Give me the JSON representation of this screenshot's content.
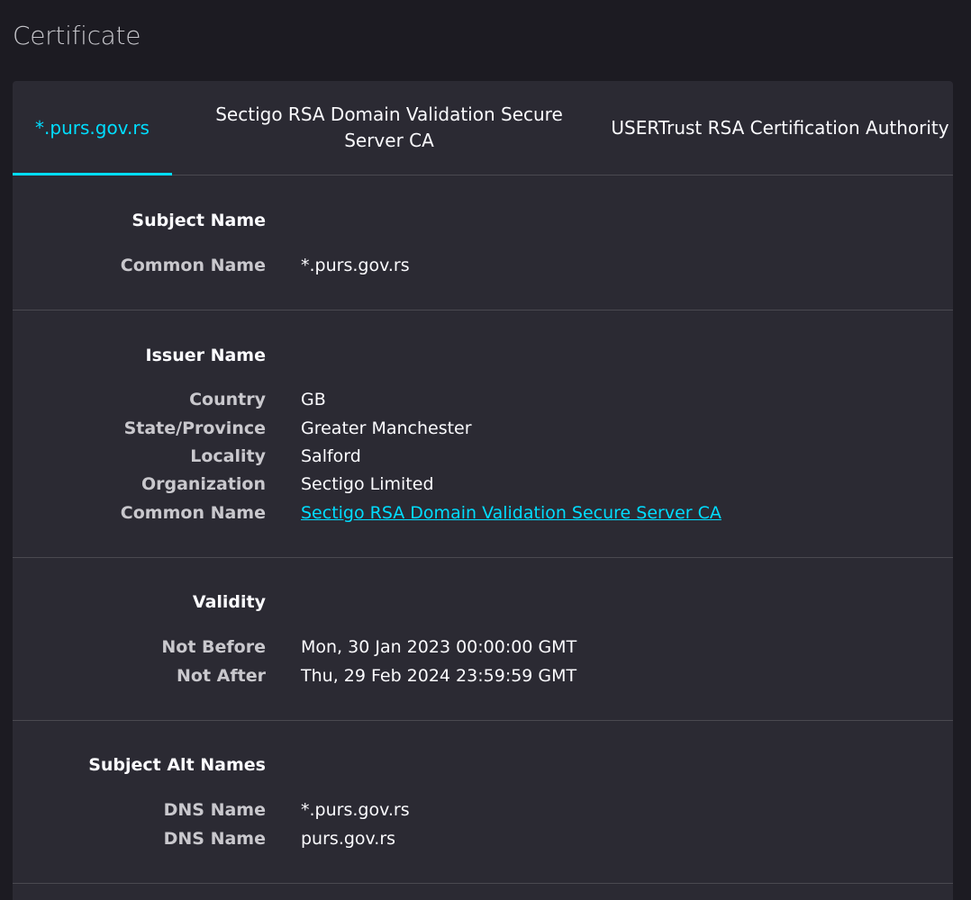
{
  "page": {
    "title": "Certificate"
  },
  "tabs": [
    {
      "label": "*.purs.gov.rs",
      "selected": true
    },
    {
      "label": "Sectigo RSA Domain Validation Secure Server CA",
      "selected": false
    },
    {
      "label": "USERTrust RSA Certification Authority",
      "selected": false
    }
  ],
  "sections": {
    "subject": {
      "heading": "Subject Name",
      "rows": [
        {
          "label": "Common Name",
          "value": "*.purs.gov.rs"
        }
      ]
    },
    "issuer": {
      "heading": "Issuer Name",
      "rows": [
        {
          "label": "Country",
          "value": "GB"
        },
        {
          "label": "State/Province",
          "value": "Greater Manchester"
        },
        {
          "label": "Locality",
          "value": "Salford"
        },
        {
          "label": "Organization",
          "value": "Sectigo Limited"
        },
        {
          "label": "Common Name",
          "value": "Sectigo RSA Domain Validation Secure Server CA"
        }
      ]
    },
    "validity": {
      "heading": "Validity",
      "rows": [
        {
          "label": "Not Before",
          "value": "Mon, 30 Jan 2023 00:00:00 GMT"
        },
        {
          "label": "Not After",
          "value": "Thu, 29 Feb 2024 23:59:59 GMT"
        }
      ]
    },
    "alt_names": {
      "heading": "Subject Alt Names",
      "rows": [
        {
          "label": "DNS Name",
          "value": "*.purs.gov.rs"
        },
        {
          "label": "DNS Name",
          "value": "purs.gov.rs"
        }
      ]
    }
  },
  "colors": {
    "background": "#1c1b22",
    "card": "#2b2a33",
    "accent": "#00ddff",
    "divider": "#4a4950",
    "label": "#c9c8cd",
    "text": "#fbfbfe"
  }
}
